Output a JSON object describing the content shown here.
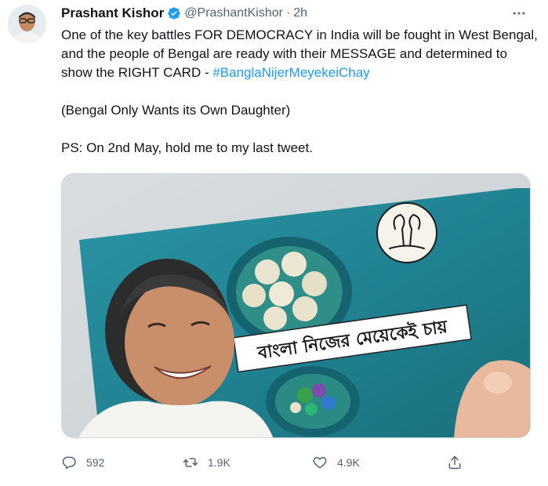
{
  "author": {
    "name": "Prashant Kishor",
    "handle": "@PrashantKishor",
    "separator": "·",
    "time": "2h"
  },
  "tweet": {
    "line_1_prefix": "One of the key battles FOR DEMOCRACY in India will be fought in West Bengal, and the people of Bengal are ready with their MESSAGE and determined to show the RIGHT CARD - ",
    "hashtag": "#BanglaNijerMeyekeiChay",
    "line_2": "(Bengal Only Wants its Own Daughter)",
    "line_3": "PS: On 2nd May, hold me to my last tweet."
  },
  "media": {
    "card_text": "বাংলা নিজের মেয়েকেই চায়"
  },
  "actions": {
    "replies": "592",
    "retweets": "1.9K",
    "likes": "4.9K"
  },
  "colors": {
    "accent": "#1d9bf0",
    "muted": "#536471",
    "text": "#0f1419",
    "card_teal": "#1f7f8e"
  },
  "icons": [
    "verified-badge-icon",
    "more-options-icon",
    "reply-icon",
    "retweet-icon",
    "like-icon",
    "share-icon"
  ]
}
